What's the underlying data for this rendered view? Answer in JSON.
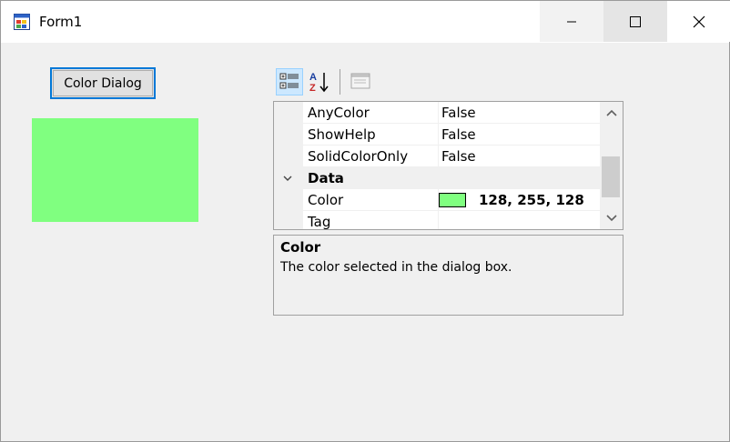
{
  "window": {
    "title": "Form1",
    "controls": [
      "minimize",
      "maximize",
      "close"
    ]
  },
  "form": {
    "button_label": "Color Dialog",
    "panel_color": "#80ff80"
  },
  "property_grid": {
    "toolbar": {
      "categorized_active": true,
      "buttons": [
        "categorized-icon",
        "alphabetical-icon",
        "property-pages-icon"
      ]
    },
    "rows": [
      {
        "name": "AnyColor",
        "value": "False"
      },
      {
        "name": "ShowHelp",
        "value": "False"
      },
      {
        "name": "SolidColorOnly",
        "value": "False"
      },
      {
        "category": "Data",
        "expanded": true
      },
      {
        "name": "Color",
        "value": "128, 255, 128",
        "swatch": "#80ff80"
      },
      {
        "name": "Tag",
        "value": ""
      }
    ],
    "help": {
      "title": "Color",
      "description": "The color selected in the dialog box."
    }
  },
  "colors": {
    "accent": "#0078d7",
    "window_bg": "#f0f0f0",
    "selected_color": "#80ff80"
  }
}
